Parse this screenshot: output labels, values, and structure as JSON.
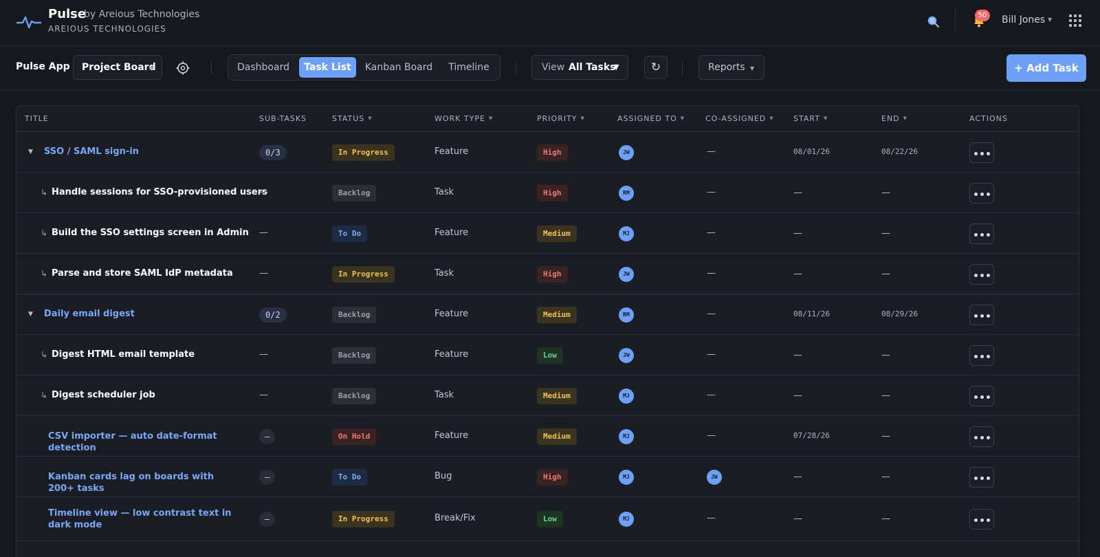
{
  "header": {
    "brand": "Pulse",
    "brand_by": "by Areious Technologies",
    "brand_sub": "AREIOUS TECHNOLOGIES",
    "notification_count": "50",
    "user_name": "Bill Jones",
    "icons": [
      "pulse-logo-icon",
      "search-icon",
      "bell-icon",
      "apps-grid-icon"
    ]
  },
  "toolbar": {
    "app_label": "Pulse App",
    "project_select": "Project Board",
    "tabs": [
      {
        "label": "Dashboard",
        "active": false
      },
      {
        "label": "Task List",
        "active": true
      },
      {
        "label": "Kanban Board",
        "active": false
      },
      {
        "label": "Timeline",
        "active": false
      }
    ],
    "view_label": "View",
    "view_value": "All Tasks",
    "reports_label": "Reports",
    "add_task_label": "+ Add Task",
    "accent_color": "#6ea0f5"
  },
  "table": {
    "columns": [
      "TITLE",
      "SUB-TASKS",
      "STATUS",
      "WORK TYPE",
      "PRIORITY",
      "ASSIGNED TO",
      "CO-ASSIGNED",
      "START",
      "END",
      "ACTIONS"
    ],
    "rows": [
      {
        "kind": "parent",
        "title": "SSO / SAML sign-in",
        "subtasks": "0/3",
        "status": "In Progress",
        "status_key": "inprogress",
        "work_type": "Feature",
        "priority": "High",
        "priority_key": "high",
        "assigned": "JW",
        "co_assigned": "—",
        "start": "08/01/26",
        "end": "08/22/26"
      },
      {
        "kind": "child",
        "title": "Handle sessions for SSO-provisioned users",
        "subtasks": "—",
        "status": "Backlog",
        "status_key": "backlog",
        "work_type": "Task",
        "priority": "High",
        "priority_key": "high",
        "assigned": "RM",
        "co_assigned": "—",
        "start": "—",
        "end": "—"
      },
      {
        "kind": "child",
        "title": "Build the SSO settings screen in Admin",
        "subtasks": "—",
        "status": "To Do",
        "status_key": "todo",
        "work_type": "Feature",
        "priority": "Medium",
        "priority_key": "medium",
        "assigned": "MJ",
        "co_assigned": "—",
        "start": "—",
        "end": "—"
      },
      {
        "kind": "child",
        "title": "Parse and store SAML IdP metadata",
        "subtasks": "—",
        "status": "In Progress",
        "status_key": "inprogress",
        "work_type": "Task",
        "priority": "High",
        "priority_key": "high",
        "assigned": "JW",
        "co_assigned": "—",
        "start": "—",
        "end": "—"
      },
      {
        "kind": "parent",
        "title": "Daily email digest",
        "subtasks": "0/2",
        "status": "Backlog",
        "status_key": "backlog",
        "work_type": "Feature",
        "priority": "Medium",
        "priority_key": "medium",
        "assigned": "RM",
        "co_assigned": "—",
        "start": "08/11/26",
        "end": "08/29/26"
      },
      {
        "kind": "child",
        "title": "Digest HTML email template",
        "subtasks": "—",
        "status": "Backlog",
        "status_key": "backlog",
        "work_type": "Feature",
        "priority": "Low",
        "priority_key": "low",
        "assigned": "JW",
        "co_assigned": "—",
        "start": "—",
        "end": "—"
      },
      {
        "kind": "child",
        "title": "Digest scheduler job",
        "subtasks": "—",
        "status": "Backlog",
        "status_key": "backlog",
        "work_type": "Task",
        "priority": "Medium",
        "priority_key": "medium",
        "assigned": "MJ",
        "co_assigned": "—",
        "start": "—",
        "end": "—"
      },
      {
        "kind": "top",
        "title": "CSV importer — auto date-format detection",
        "subtasks": "—",
        "status": "On Hold",
        "status_key": "onhold",
        "work_type": "Feature",
        "priority": "Medium",
        "priority_key": "medium",
        "assigned": "MJ",
        "co_assigned": "—",
        "start": "07/28/26",
        "end": "—"
      },
      {
        "kind": "top",
        "title": "Kanban cards lag on boards with 200+ tasks",
        "subtasks": "—",
        "status": "To Do",
        "status_key": "todo",
        "work_type": "Bug",
        "priority": "High",
        "priority_key": "high",
        "assigned": "MJ",
        "co_assigned": "JW",
        "start": "—",
        "end": "—"
      },
      {
        "kind": "top",
        "title": "Timeline view — low contrast text in dark mode",
        "subtasks": "—",
        "status": "In Progress",
        "status_key": "inprogress",
        "work_type": "Break/Fix",
        "priority": "Low",
        "priority_key": "low",
        "assigned": "MJ",
        "co_assigned": "—",
        "start": "—",
        "end": "—"
      }
    ]
  }
}
